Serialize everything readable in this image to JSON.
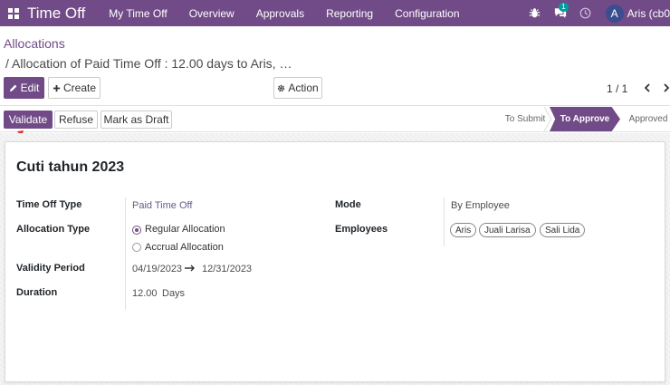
{
  "navbar": {
    "app_title": "Time Off",
    "menu": [
      "My Time Off",
      "Overview",
      "Approvals",
      "Reporting",
      "Configuration"
    ],
    "messages_count": "1",
    "avatar_letter": "A",
    "user_name": "Aris (cb0"
  },
  "control_panel": {
    "breadcrumb_root": "Allocations",
    "breadcrumb_current": "/ Allocation of Paid Time Off : 12.00 days to Aris, …",
    "edit_label": "Edit",
    "create_label": "Create",
    "action_label": "Action",
    "pager_value": "1 / 1"
  },
  "statusbar": {
    "validate_label": "Validate",
    "refuse_label": "Refuse",
    "draft_label": "Mark as Draft",
    "stages": [
      "To Submit",
      "To Approve",
      "Approved"
    ],
    "active_stage": "To Approve"
  },
  "form": {
    "title": "Cuti tahun 2023",
    "time_off_type_label": "Time Off Type",
    "time_off_type_value": "Paid Time Off",
    "allocation_type_label": "Allocation Type",
    "allocation_options": [
      "Regular Allocation",
      "Accrual Allocation"
    ],
    "allocation_selected": "Regular Allocation",
    "validity_label": "Validity Period",
    "validity_from": "04/19/2023",
    "validity_to": "12/31/2023",
    "duration_label": "Duration",
    "duration_value": "12.00",
    "duration_unit": "Days",
    "mode_label": "Mode",
    "mode_value": "By Employee",
    "employees_label": "Employees",
    "employees": [
      "Aris",
      "Juali Larisa",
      "Sali Lida"
    ]
  },
  "colors": {
    "brand": "#714b87",
    "annotation_arrow": "#e03131"
  },
  "icons": {
    "apps": "apps-grid-icon",
    "bug": "bug-icon",
    "chat": "chat-icon",
    "clock": "clock-icon",
    "edit": "pencil-icon",
    "create": "plus-icon",
    "action": "gear-icon",
    "prev": "chevron-left-icon",
    "next": "chevron-right-icon",
    "arrow": "arrow-right-icon"
  }
}
